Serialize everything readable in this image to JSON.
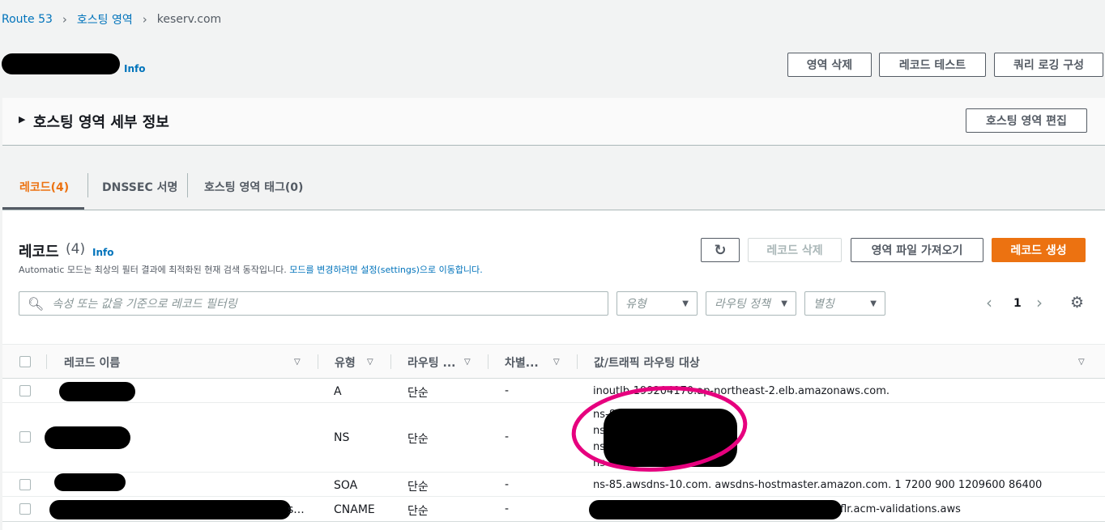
{
  "breadcrumb": [
    "Route 53",
    "호스팅 영역",
    "keserv.com"
  ],
  "header": {
    "info": "Info",
    "buttons": [
      "영역 삭제",
      "레코드 테스트",
      "쿼리 로깅 구성"
    ]
  },
  "details": {
    "title": "호스팅 영역 세부 정보",
    "edit": "호스팅 영역 편집"
  },
  "tabs": [
    "레코드(4)",
    "DNSSEC 서명",
    "호스팅 영역 태그(0)"
  ],
  "records": {
    "title": "레코드",
    "count": "(4)",
    "info": "Info",
    "desc_pre": "Automatic 모드는 최상의 필터 결과에 최적화된 현재 검색 동작입니다. ",
    "desc_link": "모드를 변경하려면 설정(settings)으로 이동합니다.",
    "delete": "레코드 삭제",
    "import": "영역 파일 가져오기",
    "create": "레코드 생성",
    "search_placeholder": "속성 또는 값을 기준으로 레코드 필터링",
    "filters": [
      "유형",
      "라우팅 정책",
      "별칭"
    ],
    "page": "1",
    "columns": [
      "레코드 이름",
      "유형",
      "라우팅 ...",
      "차별...",
      "값/트래픽 라우팅 대상"
    ],
    "rows": [
      {
        "type": "A",
        "routing": "단순",
        "diff": "-",
        "value": "inoutlb-199204170.ap-northeast-2.elb.amazonaws.com."
      },
      {
        "type": "NS",
        "routing": "단순",
        "diff": "-",
        "value_lines": [
          "ns-85",
          "ns",
          "ns",
          "ns .org."
        ]
      },
      {
        "type": "SOA",
        "routing": "단순",
        "diff": "-",
        "value": "ns-85.awsdns-10.com. awsdns-hostmaster.amazon.com. 1 7200 900 1209600 86400"
      },
      {
        "name_suffix": "s...",
        "type": "CNAME",
        "routing": "단순",
        "diff": "-",
        "value": "flr.acm-validations.aws"
      }
    ]
  },
  "colors": {
    "accent": "#ec7211",
    "link": "#0073bb",
    "annotation": "#e6007e"
  }
}
